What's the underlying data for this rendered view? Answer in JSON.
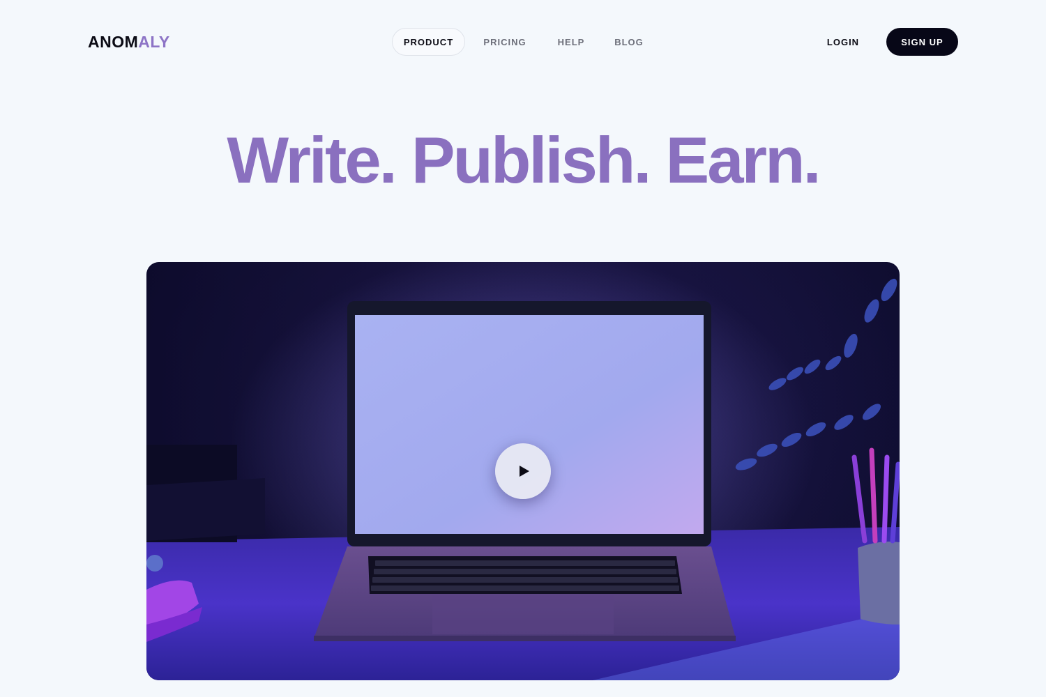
{
  "brand": {
    "logo_dark": "ANOM",
    "logo_light": "ALY"
  },
  "nav": {
    "items": [
      {
        "label": "PRODUCT",
        "active": true
      },
      {
        "label": "PRICING",
        "active": false
      },
      {
        "label": "HELP",
        "active": false
      },
      {
        "label": "BLOG",
        "active": false
      }
    ]
  },
  "auth": {
    "login_label": "LOGIN",
    "signup_label": "SIGN UP"
  },
  "hero": {
    "headline": "Write. Publish. Earn."
  },
  "video": {
    "play_icon": "play-icon"
  },
  "colors": {
    "accent": "#8a70bf",
    "button_dark": "#070717",
    "background": "#f4f8fc"
  }
}
